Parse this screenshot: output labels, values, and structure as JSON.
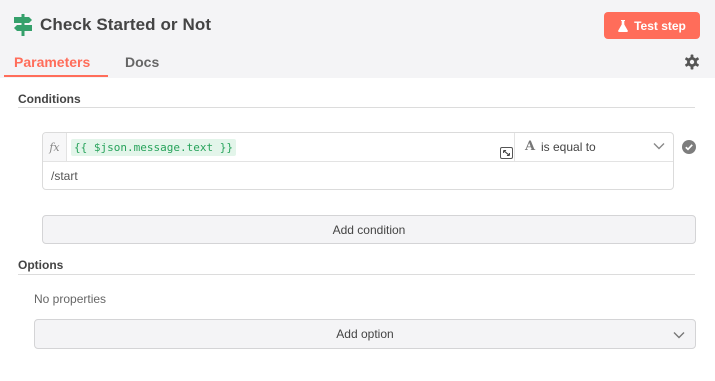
{
  "header": {
    "title": "Check Started or Not",
    "node_icon": "signpost-icon",
    "test_button_label": "Test step",
    "test_button_icon": "flask-icon",
    "accent_color": "#ff6d5a"
  },
  "tabs": [
    {
      "label": "Parameters",
      "active": true
    },
    {
      "label": "Docs",
      "active": false
    }
  ],
  "settings_icon": "gear-icon",
  "conditions": {
    "section_label": "Conditions",
    "items": [
      {
        "expression_prefix": "fx",
        "left_value": "{{ $json.message.text }}",
        "operator_type_glyph": "A",
        "operator": "is equal to",
        "right_value": "/start",
        "valid": true
      }
    ],
    "add_button_label": "Add condition"
  },
  "options": {
    "section_label": "Options",
    "empty_text": "No properties",
    "add_button_label": "Add option"
  }
}
